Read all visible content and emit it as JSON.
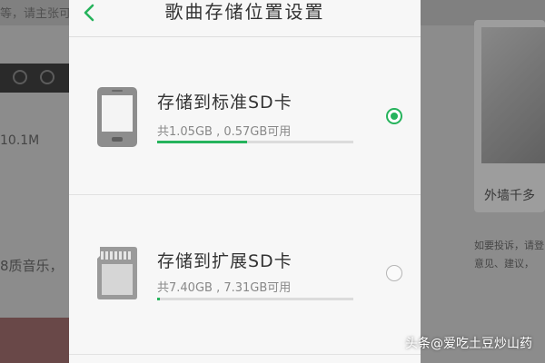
{
  "background": {
    "top_text": "等，请主张可",
    "size_text": "10.1M",
    "music_text": "8质音乐，",
    "card_title": "外墙千多",
    "side_text_1": "如要投诉，请登",
    "side_text_2": "意见、建议，"
  },
  "dialog": {
    "title": "歌曲存储位置设置",
    "back_icon": "chevron-left-icon",
    "options": [
      {
        "label": "存储到标准SD卡",
        "detail": "共1.05GB , 0.57GB可用",
        "used_fraction": 0.46,
        "selected": true,
        "icon": "phone-icon"
      },
      {
        "label": "存储到扩展SD卡",
        "detail": "共7.40GB , 7.31GB可用",
        "used_fraction": 0.012,
        "selected": false,
        "icon": "sd-card-icon"
      }
    ]
  },
  "colors": {
    "accent": "#26b35c",
    "dialog_bg": "#f7f7f7",
    "track": "#dcdcdc"
  },
  "watermark": "头条@爱吃土豆炒山药"
}
